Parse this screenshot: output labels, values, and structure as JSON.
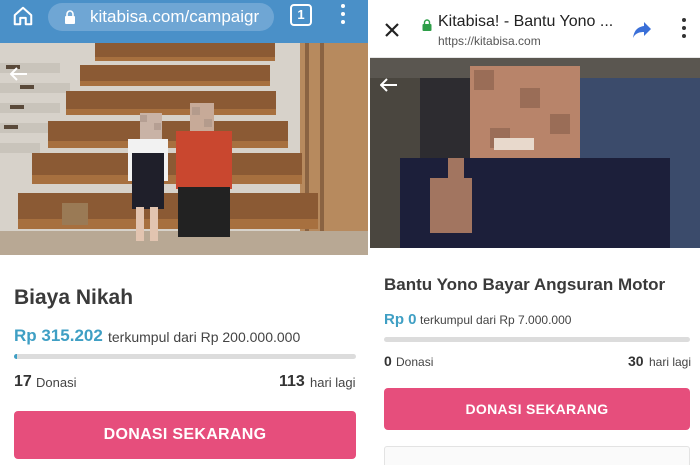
{
  "left": {
    "browser": {
      "url": "kitabisa.com/campaigr",
      "tab_count": "1",
      "home_icon": "home-icon",
      "lock_icon": "lock-icon",
      "menu_icon": "more-vert-icon"
    },
    "campaign": {
      "title": "Biaya Nikah",
      "amount": "Rp 315.202",
      "raised_text": "terkumpul dari Rp 200.000.000",
      "progress": 0.0016,
      "donations_count": "17",
      "donations_label": "Donasi",
      "days_left_count": "113",
      "days_left_label": "hari lagi",
      "cta_label": "DONASI SEKARANG"
    }
  },
  "right": {
    "app_bar": {
      "title": "Kitabisa! - Bantu Yono ...",
      "url": "https://kitabisa.com",
      "close_icon": "close-icon",
      "share_icon": "share-icon",
      "menu_icon": "more-vert-icon"
    },
    "campaign": {
      "title": "Bantu Yono Bayar Angsuran Motor",
      "amount": "Rp 0",
      "raised_text": "terkumpul dari Rp 7.000.000",
      "progress": 0,
      "donations_count": "0",
      "donations_label": "Donasi",
      "days_left_count": "30",
      "days_left_label": "hari lagi",
      "cta_label": "DONASI SEKARANG"
    }
  },
  "colors": {
    "browser_bar": "#4a90c8",
    "accent_blue": "#3f9fc4",
    "cta_pink": "#e64e7c"
  }
}
